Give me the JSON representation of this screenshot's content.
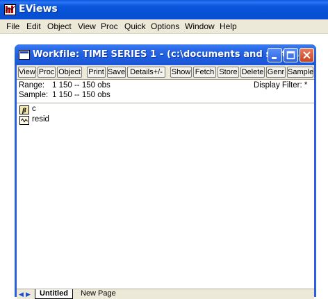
{
  "app": {
    "title": "EViews",
    "menu": [
      "File",
      "Edit",
      "Object",
      "View",
      "Proc",
      "Quick",
      "Options",
      "Window",
      "Help"
    ]
  },
  "workfile_window": {
    "title": "Workfile: TIME SERIES 1 - (c:\\documents and settin...",
    "toolbar": [
      "View",
      "Proc",
      "Object",
      "Print",
      "Save",
      "Details+/-",
      "Show",
      "Fetch",
      "Store",
      "Delete",
      "Genr",
      "Sample"
    ],
    "range_label": "Range:",
    "range_value": "1 150  --  150 obs",
    "sample_label": "Sample:",
    "sample_value": "1 150  --  150 obs",
    "display_filter": "Display Filter: *",
    "objects": [
      {
        "name": "c",
        "icon": "coefficient-icon"
      },
      {
        "name": "resid",
        "icon": "series-icon"
      }
    ],
    "tabs": [
      "Untitled",
      "New Page"
    ]
  },
  "colors": {
    "titlebar": "#0a57e0",
    "workspace": "#ffffff",
    "panel": "#ece9d8",
    "close_button": "#c8421f"
  }
}
